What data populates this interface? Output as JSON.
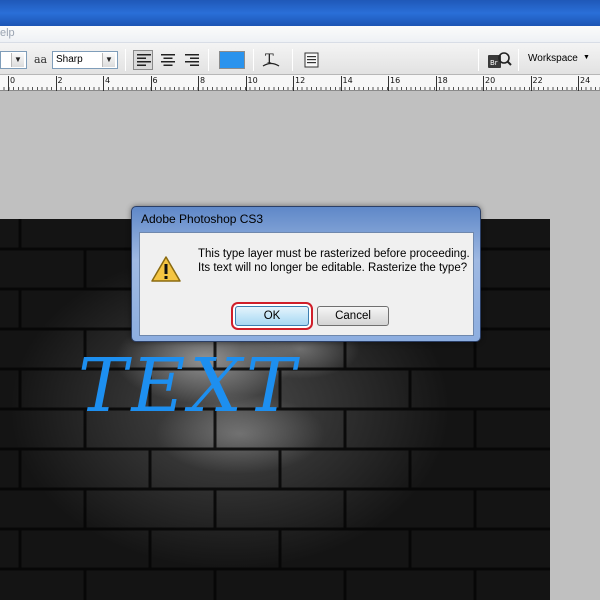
{
  "menu": {
    "help_fragment": "elp"
  },
  "options_bar": {
    "antialias_icon": "aa",
    "antialias_value": "Sharp",
    "text_color": "#2a93ed",
    "workspace_label": "Workspace",
    "icons": [
      "left-align-icon",
      "center-align-icon",
      "right-align-icon",
      "warp-text-icon",
      "character-panel-icon",
      "bridge-icon"
    ]
  },
  "ruler": {
    "labels": [
      "0",
      "2",
      "4",
      "6",
      "8",
      "10",
      "12",
      "14",
      "16",
      "18",
      "20",
      "22",
      "24"
    ]
  },
  "canvas": {
    "text": "TEXT",
    "text_color": "#1d8ff0"
  },
  "dialog": {
    "title": "Adobe Photoshop CS3",
    "message": "This type layer must be rasterized before proceeding.  Its text will no longer be editable. Rasterize the type?",
    "ok_label": "OK",
    "cancel_label": "Cancel",
    "icon": "warning-icon"
  }
}
